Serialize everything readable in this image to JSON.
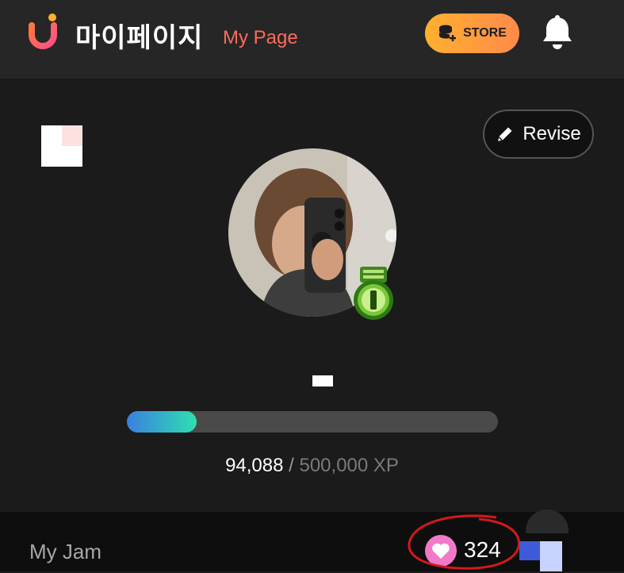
{
  "header": {
    "title_ko": "마이페이지",
    "title_en": "My Page",
    "store_label": "STORE"
  },
  "profile": {
    "revise_label": "Revise",
    "xp_current": "94,088",
    "xp_separator": " / ",
    "xp_max": "500,000 XP",
    "xp_progress_fraction": 0.188
  },
  "bottom": {
    "myjam_label": "My Jam",
    "likes_count": "324"
  },
  "colors": {
    "accent_title": "#ff6a5c",
    "store_gradient_start": "#ffb02e",
    "store_gradient_end": "#ff8a4c",
    "xp_gradient_start": "#3b7fe0",
    "xp_gradient_end": "#2ee0b0",
    "heart_pink": "#f07ac8",
    "annotation_red": "#d3181f"
  },
  "icons": {
    "logo": "u-logo-icon",
    "store": "coins-plus-icon",
    "bell": "bell-icon",
    "revise": "pencil-icon",
    "medal": "medal-icon",
    "heart": "heart-icon"
  }
}
